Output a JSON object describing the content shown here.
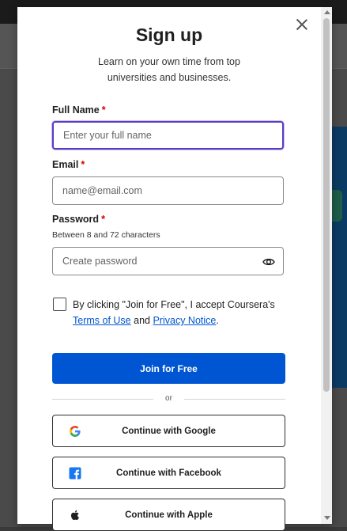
{
  "modal": {
    "title": "Sign up",
    "subtitle": "Learn on your own time from top universities and businesses."
  },
  "form": {
    "full_name": {
      "label": "Full Name",
      "required_mark": "*",
      "placeholder": "Enter your full name",
      "value": ""
    },
    "email": {
      "label": "Email",
      "required_mark": "*",
      "placeholder": "name@email.com",
      "value": ""
    },
    "password": {
      "label": "Password",
      "required_mark": "*",
      "hint": "Between 8 and 72 characters",
      "placeholder": "Create password",
      "value": ""
    },
    "consent": {
      "prefix": "By clicking \"Join for Free\", I accept Coursera's",
      "terms_link": "Terms of Use",
      "and": "and",
      "privacy_link": "Privacy Notice",
      "suffix": ".",
      "checked": false
    },
    "submit_label": "Join for Free"
  },
  "divider_text": "or",
  "social": {
    "google": "Continue with Google",
    "facebook": "Continue with Facebook",
    "apple": "Continue with Apple"
  },
  "colors": {
    "primary": "#0056d2",
    "required": "#d30001",
    "focus_border": "#5b3cc4"
  },
  "icons": [
    "close-icon",
    "eye-icon",
    "google-icon",
    "facebook-icon",
    "apple-icon"
  ]
}
